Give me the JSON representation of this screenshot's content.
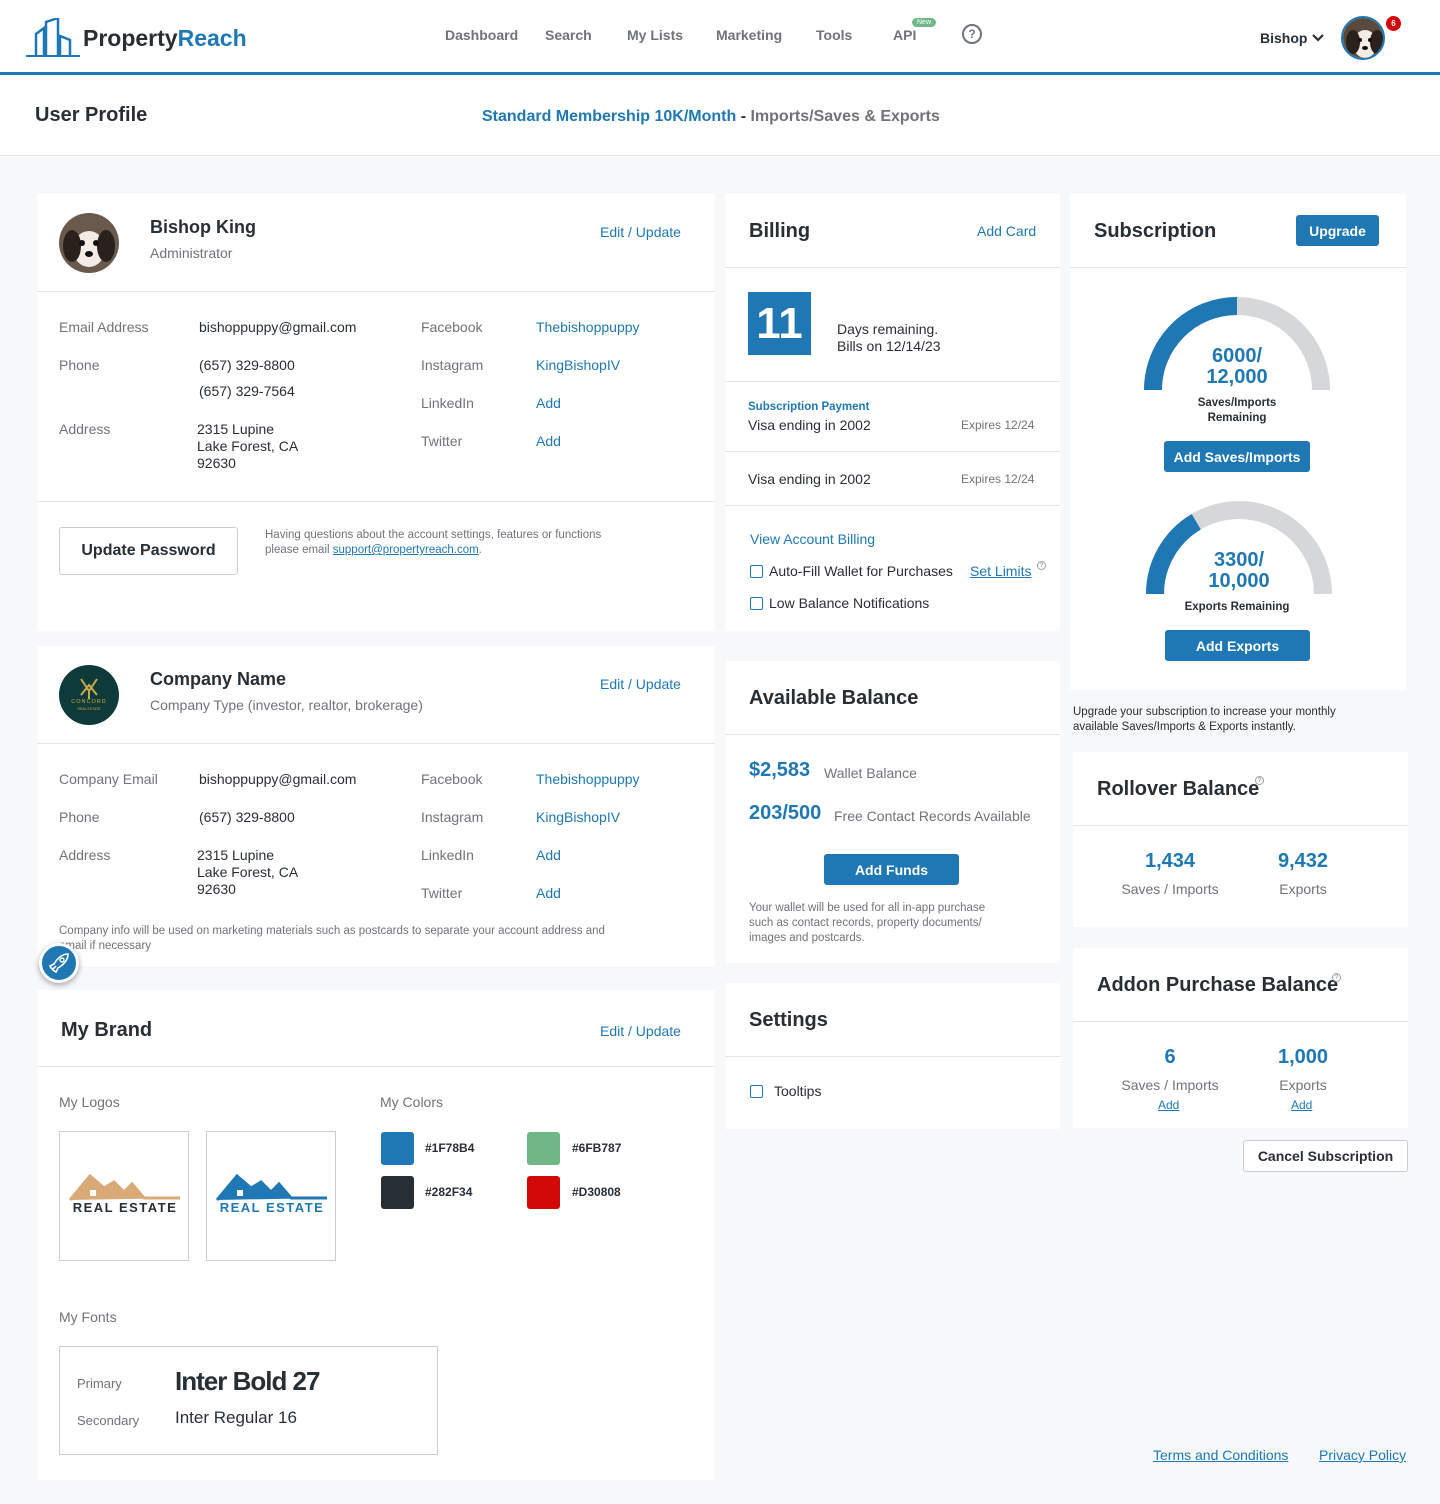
{
  "header": {
    "brand_name": {
      "a": "Property",
      "b": "Reach"
    },
    "nav": [
      {
        "label": "Dashboard"
      },
      {
        "label": "Search"
      },
      {
        "label": "My Lists"
      },
      {
        "label": "Marketing"
      },
      {
        "label": "Tools"
      },
      {
        "label": "API",
        "badge": "New"
      }
    ],
    "help_icon": "question-circle-icon",
    "user_name": "Bishop",
    "notification_count": "6",
    "accent_color": "#1f78b4"
  },
  "subheader": {
    "title": "User Profile",
    "membership": "Standard Membership 10K/Month",
    "separator": "-",
    "membership_detail": "Imports/Saves & Exports"
  },
  "profile": {
    "name": "Bishop King",
    "role": "Administrator",
    "edit_label": "Edit / Update",
    "email_label": "Email Address",
    "email": "bishoppuppy@gmail.com",
    "phone_label": "Phone",
    "phone1": "(657) 329-8800",
    "phone2": "(657) 329-7564",
    "address_label": "Address",
    "address1": "2315 Lupine",
    "address2": "Lake Forest, CA",
    "address3": "92630",
    "facebook_label": "Facebook",
    "facebook": "Thebishoppuppy",
    "instagram_label": "Instagram",
    "instagram": "KingBishopIV",
    "linkedin_label": "LinkedIn",
    "linkedin": "Add",
    "twitter_label": "Twitter",
    "twitter": "Add",
    "update_password": "Update Password",
    "help_text": "Having questions about the account settings, features or functions",
    "help_text2": "please email ",
    "support_email": "support@propertyreach.com",
    "help_end": "."
  },
  "company": {
    "name": "Company Name",
    "type": "Company Type (investor, realtor, brokerage)",
    "edit_label": "Edit / Update",
    "email_label": "Company Email",
    "email": "bishoppuppy@gmail.com",
    "phone_label": "Phone",
    "phone": "(657) 329-8800",
    "address_label": "Address",
    "address1": "2315 Lupine",
    "address2": "Lake Forest, CA",
    "address3": "92630",
    "facebook_label": "Facebook",
    "facebook": "Thebishoppuppy",
    "instagram_label": "Instagram",
    "instagram": "KingBishopIV",
    "linkedin_label": "LinkedIn",
    "linkedin": "Add",
    "twitter_label": "Twitter",
    "twitter": "Add",
    "note1": "Company info will be used on marketing materials such as postcards to separate your account address and",
    "note2": "email if necessary",
    "logo_text": "CONCORD",
    "logo_sub": "REAL ESTATE"
  },
  "brand": {
    "title": "My Brand",
    "edit_label": "Edit / Update",
    "logos_label": "My Logos",
    "logo1_text": "REAL ESTATE",
    "logo2_text": "REAL ESTATE",
    "colors_label": "My Colors",
    "colors": [
      {
        "hex": "#1F78B4",
        "color": "#1F78B4"
      },
      {
        "hex": "#6FB787",
        "color": "#6FB787"
      },
      {
        "hex": "#282F34",
        "color": "#282F34"
      },
      {
        "hex": "#D30808",
        "color": "#D30808"
      }
    ],
    "fonts_label": "My Fonts",
    "primary_label": "Primary",
    "primary_font": "Inter Bold 27",
    "secondary_label": "Secondary",
    "secondary_font": "Inter Regular 16"
  },
  "billing": {
    "title": "Billing",
    "add_card": "Add Card",
    "days": "11",
    "days_text": "Days remaining.",
    "bills_on": "Bills on 12/14/23",
    "sub_payment_label": "Subscription Payment",
    "card1": "Visa ending in 2002",
    "card1_exp": "Expires 12/24",
    "card2": "Visa ending in 2002",
    "card2_exp": "Expires 12/24",
    "view_billing": "View Account Billing",
    "autofill": "Auto-Fill Wallet for Purchases",
    "set_limits": "Set Limits",
    "low_balance": "Low Balance Notifications"
  },
  "available": {
    "title": "Available Balance",
    "wallet_amount": "$2,583",
    "wallet_label": "Wallet Balance",
    "records": "203/500",
    "records_label": "Free Contact Records Available",
    "add_funds": "Add Funds",
    "note1": "Your wallet will be used for all in-app purchase",
    "note2": "such as contact records, property documents/",
    "note3": "images and postcards."
  },
  "settings": {
    "title": "Settings",
    "tooltips": "Tooltips"
  },
  "subscription": {
    "title": "Subscription",
    "upgrade": "Upgrade",
    "gauge1": {
      "used": 6000,
      "total": 12000,
      "line1": "6000/",
      "line2": "12,000",
      "label1": "Saves/Imports",
      "label2": "Remaining"
    },
    "add_saves": "Add Saves/Imports",
    "gauge2": {
      "used": 3300,
      "total": 10000,
      "line1": "3300/",
      "line2": "10,000",
      "label1": "Exports Remaining"
    },
    "add_exports": "Add Exports",
    "note1": "Upgrade your subscription to increase your monthly",
    "note2": "available Saves/Imports & Exports instantly."
  },
  "rollover": {
    "title": "Rollover Balance",
    "saves": "1,434",
    "saves_label": "Saves / Imports",
    "exports": "9,432",
    "exports_label": "Exports"
  },
  "addon": {
    "title": "Addon Purchase Balance",
    "saves": "6",
    "saves_label": "Saves / Imports",
    "saves_add": "Add",
    "exports": "1,000",
    "exports_label": "Exports",
    "exports_add": "Add"
  },
  "cancel": "Cancel Subscription",
  "footer": {
    "terms": "Terms and Conditions",
    "privacy": "Privacy Policy"
  }
}
